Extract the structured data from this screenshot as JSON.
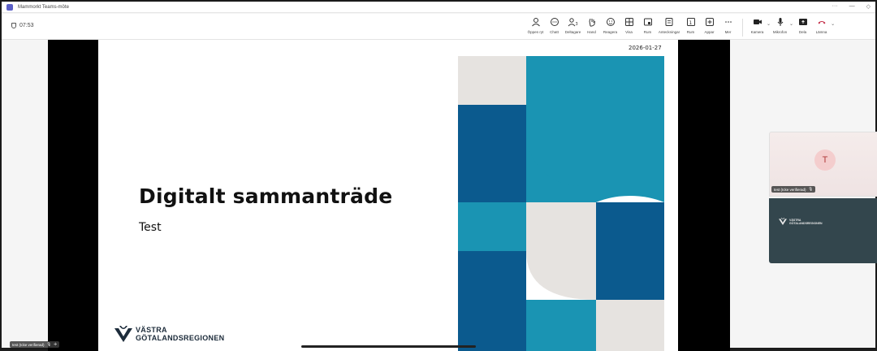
{
  "window": {
    "title": "Mammorkt Teams-möte",
    "controls": [
      "···",
      "—",
      "◇"
    ]
  },
  "toolbar": {
    "timer": "07:53",
    "tools": [
      {
        "icon": "people-icon",
        "label": "Öppen ryt"
      },
      {
        "icon": "chat-icon",
        "label": "Chatt"
      },
      {
        "icon": "participants-icon",
        "label": "Deltagare"
      },
      {
        "icon": "raise-hand-icon",
        "label": "Hand"
      },
      {
        "icon": "react-icon",
        "label": "Reagera"
      },
      {
        "icon": "view-icon",
        "label": "Visa"
      },
      {
        "icon": "rooms-icon",
        "label": "Rum"
      },
      {
        "icon": "notes-icon",
        "label": "Anteckningar"
      },
      {
        "icon": "room-icon",
        "label": "Rum"
      },
      {
        "icon": "apps-icon",
        "label": "Appar"
      },
      {
        "icon": "more-icon",
        "label": "Mer"
      }
    ],
    "camera_label": "Kamera",
    "mic_label": "Mikrofon",
    "share_label": "Dela",
    "leave_label": "Lämna"
  },
  "slide": {
    "date": "2026-01-27",
    "title": "Digitalt sammanträde",
    "subtitle": "Test",
    "logo_line1": "VÄSTRA",
    "logo_line2": "GÖTALANDSREGIONEN"
  },
  "participants": [
    {
      "initial": "T",
      "name": "test (Icke verifierad)"
    },
    {
      "name": "Västra Götalandsregionen"
    }
  ],
  "share_tile": {
    "logo_line1": "VÄSTRA",
    "logo_line2": "GÖTALANDSREGIONEN"
  },
  "self_view": {
    "name": "test (Icke verifierad)"
  },
  "colors": {
    "blue_dark": "#0b5a8e",
    "blue_mid": "#1a94b3",
    "grey_tile": "#e6e3e0",
    "leave_red": "#c4314b"
  }
}
